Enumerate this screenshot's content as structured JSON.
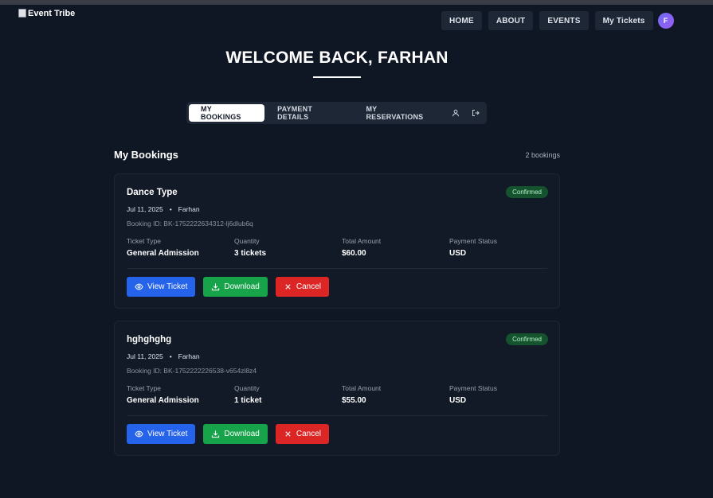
{
  "app": {
    "logo_text": "Event Tribe"
  },
  "nav": {
    "items": [
      "HOME",
      "ABOUT",
      "EVENTS",
      "My Tickets"
    ],
    "avatar_initial": "F"
  },
  "header": {
    "welcome": "WELCOME BACK, FARHAN"
  },
  "tabs": {
    "items": [
      "MY BOOKINGS",
      "PAYMENT DETAILS",
      "MY RESERVATIONS"
    ],
    "active": "MY BOOKINGS",
    "icons": [
      "user-icon",
      "logout-icon"
    ]
  },
  "bookings_section": {
    "title": "My Bookings",
    "count": "2 bookings"
  },
  "bookings": [
    {
      "title": "Dance Type",
      "status": "Confirmed",
      "date": "Jul 11, 2025",
      "separator": "•",
      "name": "Farhan",
      "booking_id": "Booking ID: BK-1752222634312-lj6dlub6q",
      "fields": [
        {
          "label": "Ticket Type",
          "value": "General Admission"
        },
        {
          "label": "Quantity",
          "value": "3 tickets"
        },
        {
          "label": "Total Amount",
          "value": "$60.00"
        },
        {
          "label": "Payment Status",
          "value": "USD"
        }
      ],
      "actions": {
        "view": "View Ticket",
        "download": "Download",
        "cancel": "Cancel"
      }
    },
    {
      "title": "hghghghg",
      "status": "Confirmed",
      "date": "Jul 11, 2025",
      "separator": "•",
      "name": "Farhan",
      "booking_id": "Booking ID: BK-1752222226538-v654zl8z4",
      "fields": [
        {
          "label": "Ticket Type",
          "value": "General Admission"
        },
        {
          "label": "Quantity",
          "value": "1 ticket"
        },
        {
          "label": "Total Amount",
          "value": "$55.00"
        },
        {
          "label": "Payment Status",
          "value": "USD"
        }
      ],
      "actions": {
        "view": "View Ticket",
        "download": "Download",
        "cancel": "Cancel"
      }
    }
  ],
  "colors": {
    "background": "#0f1624",
    "card": "#121a28",
    "view_button": "#2563eb",
    "download_button": "#16a34a",
    "cancel_button": "#dc2626",
    "confirmed_badge": "#14532d",
    "avatar": "#7c65f2"
  }
}
